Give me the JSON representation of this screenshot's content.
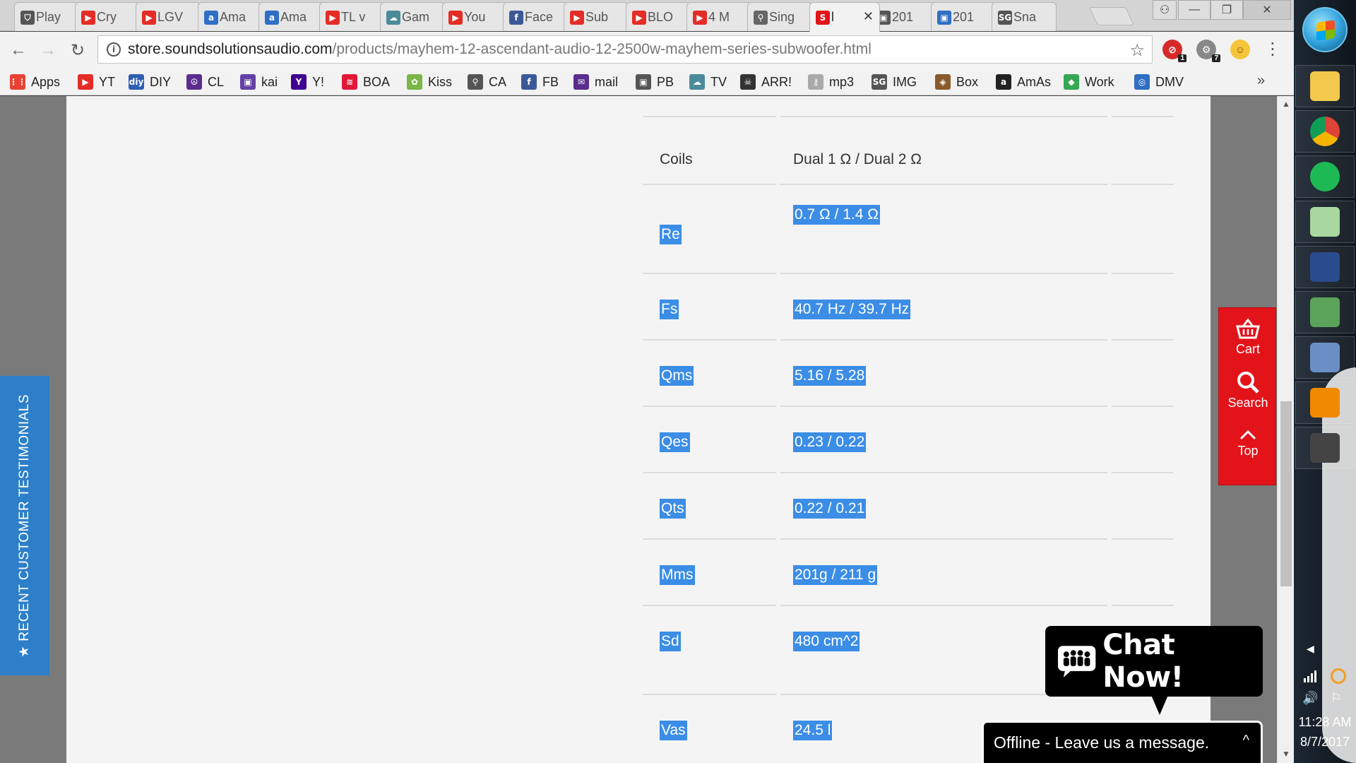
{
  "tabs": [
    {
      "label": "Play",
      "icon": "shield-icon",
      "color": "#555555",
      "glyph": "⛉"
    },
    {
      "label": "Cry",
      "icon": "youtube-icon",
      "color": "#e52d27",
      "glyph": "▶"
    },
    {
      "label": "LGV",
      "icon": "youtube-icon",
      "color": "#e52d27",
      "glyph": "▶"
    },
    {
      "label": "Ama",
      "icon": "amazon-icon",
      "color": "#2f6fc4",
      "glyph": "a"
    },
    {
      "label": "Ama",
      "icon": "amazon-icon",
      "color": "#2f6fc4",
      "glyph": "a"
    },
    {
      "label": "TL v",
      "icon": "youtube-icon",
      "color": "#e52d27",
      "glyph": "▶"
    },
    {
      "label": "Gam",
      "icon": "cloud-icon",
      "color": "#4a8a9a",
      "glyph": "☁"
    },
    {
      "label": "You",
      "icon": "youtube-icon",
      "color": "#e52d27",
      "glyph": "▶"
    },
    {
      "label": "Face",
      "icon": "facebook-icon",
      "color": "#3b5998",
      "glyph": "f"
    },
    {
      "label": "Sub",
      "icon": "youtube-icon",
      "color": "#e52d27",
      "glyph": "▶"
    },
    {
      "label": "BLO",
      "icon": "youtube-icon",
      "color": "#e52d27",
      "glyph": "▶"
    },
    {
      "label": "4 M",
      "icon": "youtube-icon",
      "color": "#e52d27",
      "glyph": "▶"
    },
    {
      "label": "Sing",
      "icon": "antenna-icon",
      "color": "#666666",
      "glyph": "⚲"
    },
    {
      "label": "l",
      "icon": "ssa-logo-icon",
      "color": "#e3131a",
      "glyph": "S",
      "active": true
    },
    {
      "label": "201",
      "icon": "camera-icon",
      "color": "#555555",
      "glyph": "▣"
    },
    {
      "label": "201",
      "icon": "photo-icon",
      "color": "#2f6fc4",
      "glyph": "▣"
    },
    {
      "label": "Sna",
      "icon": "sg-icon",
      "color": "#555555",
      "glyph": "SG"
    }
  ],
  "window": {
    "close_glyph": "✕",
    "min_glyph": "—",
    "max_glyph": "❐",
    "user_glyph": "⚇",
    "tab_close_glyph": "✕"
  },
  "address": {
    "host": "store.soundsolutionsaudio.com",
    "path": "/products/mayhem-12-ascendant-audio-12-2500w-mayhem-series-subwoofer.html"
  },
  "extensions": [
    {
      "icon": "adblock-extension-icon",
      "glyph": "⊘",
      "badge": "1"
    },
    {
      "icon": "extension-icon",
      "glyph": "⚙",
      "badge": "7"
    },
    {
      "icon": "emoji-extension-icon",
      "glyph": "☺",
      "badge": ""
    }
  ],
  "bookmarks": [
    {
      "label": "Apps",
      "icon": "apps-grid-icon",
      "color": "#e94235",
      "glyph": "⋮⋮"
    },
    {
      "label": "YT",
      "icon": "youtube-icon",
      "color": "#e52d27",
      "glyph": "▶"
    },
    {
      "label": "DIY",
      "icon": "diy-icon",
      "color": "#2f5fb3",
      "glyph": "diy"
    },
    {
      "label": "CL",
      "icon": "peace-icon",
      "color": "#5b2d8e",
      "glyph": "☮"
    },
    {
      "label": "kai",
      "icon": "twitch-icon",
      "color": "#6441a5",
      "glyph": "▣"
    },
    {
      "label": "Y!",
      "icon": "yahoo-icon",
      "color": "#400090",
      "glyph": "Y"
    },
    {
      "label": "BOA",
      "icon": "boa-icon",
      "color": "#e31837",
      "glyph": "≋"
    },
    {
      "label": "Kiss",
      "icon": "kiss-icon",
      "color": "#7ab648",
      "glyph": "✿"
    },
    {
      "label": "CA",
      "icon": "antenna-icon",
      "color": "#555555",
      "glyph": "⚲"
    },
    {
      "label": "FB",
      "icon": "facebook-icon",
      "color": "#3b5998",
      "glyph": "f"
    },
    {
      "label": "mail",
      "icon": "mail-icon",
      "color": "#5b2d8e",
      "glyph": "✉"
    },
    {
      "label": "PB",
      "icon": "camera-icon",
      "color": "#555555",
      "glyph": "▣"
    },
    {
      "label": "TV",
      "icon": "cloud-icon",
      "color": "#4a8a9a",
      "glyph": "☁"
    },
    {
      "label": "ARR!",
      "icon": "pirate-icon",
      "color": "#333333",
      "glyph": "☠"
    },
    {
      "label": "mp3",
      "icon": "key-icon",
      "color": "#aaaaaa",
      "glyph": "⚷"
    },
    {
      "label": "IMG",
      "icon": "sg-icon",
      "color": "#555555",
      "glyph": "SG"
    },
    {
      "label": "Box",
      "icon": "box-icon",
      "color": "#8a5a2b",
      "glyph": "◈"
    },
    {
      "label": "AmAs",
      "icon": "amazon-icon",
      "color": "#222222",
      "glyph": "a"
    },
    {
      "label": "Work",
      "icon": "maps-icon",
      "color": "#34a853",
      "glyph": "◆"
    },
    {
      "label": "DMV",
      "icon": "dmv-icon",
      "color": "#2f6fc4",
      "glyph": "◎"
    }
  ],
  "bookmarks_more": "»",
  "specs": [
    {
      "name": "Coils",
      "value": "Dual 1 Ω / Dual 2 Ω",
      "highlighted": false
    },
    {
      "name": "Re",
      "value": "0.7 Ω / 1.4 Ω",
      "highlighted": true
    },
    {
      "name": "Fs",
      "value": "40.7 Hz / 39.7 Hz",
      "highlighted": true
    },
    {
      "name": "Qms",
      "value": "5.16 / 5.28",
      "highlighted": true
    },
    {
      "name": "Qes",
      "value": "0.23 / 0.22",
      "highlighted": true
    },
    {
      "name": "Qts",
      "value": "0.22 / 0.21",
      "highlighted": true
    },
    {
      "name": "Mms",
      "value": "201g / 211 g",
      "highlighted": true
    },
    {
      "name": "Sd",
      "value": "480 cm^2",
      "highlighted": true
    },
    {
      "name": "Vas",
      "value": "24.5 l",
      "highlighted": true
    }
  ],
  "testimonials_tab": "★ RECENT CUSTOMER TESTIMONIALS",
  "side_tools": {
    "cart": "Cart",
    "search": "Search",
    "top": "Top"
  },
  "chat": {
    "title": "Chat Now!",
    "offline": "Offline - Leave us a message.",
    "caret": "^"
  },
  "colors": {
    "accent_red": "#e3131a",
    "testimonial_blue": "#2e7fc9",
    "selection_blue": "#3b8de6"
  },
  "taskbar_apps": [
    {
      "icon": "file-explorer-icon",
      "color": "#f2c94c"
    },
    {
      "icon": "chrome-icon",
      "color": "#db4437"
    },
    {
      "icon": "spotify-icon",
      "color": "#1db954"
    },
    {
      "icon": "sticky-notes-icon",
      "color": "#a8d8a0"
    },
    {
      "icon": "winiso-icon",
      "color": "#2a4b8d"
    },
    {
      "icon": "task-manager-icon",
      "color": "#5ba35b"
    },
    {
      "icon": "calculator-icon",
      "color": "#6a8fc6"
    },
    {
      "icon": "vlc-icon",
      "color": "#f08a00"
    },
    {
      "icon": "mug-icon",
      "color": "#444444"
    }
  ],
  "tray": {
    "time": "11:28 AM",
    "date": "8/7/2017",
    "chevron": "◀",
    "volume": "🔊",
    "flag": "⚐"
  }
}
